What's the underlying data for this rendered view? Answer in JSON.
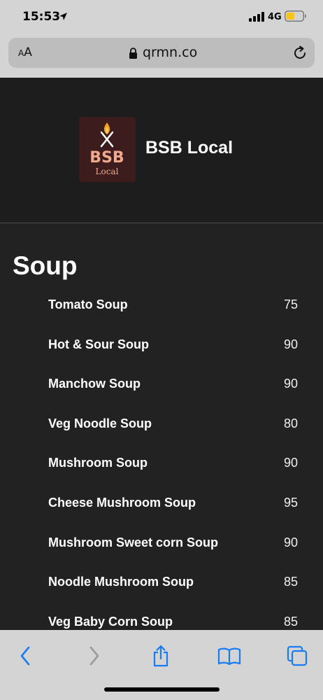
{
  "status_bar": {
    "time": "15:53",
    "network": "4G",
    "icons": [
      "location-arrow-icon",
      "signal-bars-icon",
      "battery-icon"
    ],
    "battery_color": "#f5c518"
  },
  "browser": {
    "text_size_label_small": "A",
    "text_size_label_large": "A",
    "url": "qrmn.co",
    "icons": [
      "lock-icon",
      "reload-icon"
    ]
  },
  "header": {
    "logo_text": "BSB",
    "logo_subtext": "Local",
    "title": "BSB Local",
    "logo_bg": "#3c1c1c",
    "logo_accent": "#f0a98c"
  },
  "menu": {
    "section_title": "Soup",
    "items": [
      {
        "name": "Tomato Soup",
        "price": "75"
      },
      {
        "name": "Hot & Sour Soup",
        "price": "90"
      },
      {
        "name": "Manchow Soup",
        "price": "90"
      },
      {
        "name": "Veg Noodle Soup",
        "price": "80"
      },
      {
        "name": "Mushroom Soup",
        "price": "90"
      },
      {
        "name": "Cheese Mushroom Soup",
        "price": "95"
      },
      {
        "name": "Mushroom Sweet corn Soup",
        "price": "90"
      },
      {
        "name": "Noodle Mushroom Soup",
        "price": "85"
      },
      {
        "name": "Veg Baby Corn Soup",
        "price": "85"
      }
    ]
  },
  "toolbar": {
    "icons": [
      "back-icon",
      "forward-icon",
      "share-icon",
      "bookmarks-icon",
      "tabs-icon"
    ],
    "accent": "#1a7cf5"
  }
}
